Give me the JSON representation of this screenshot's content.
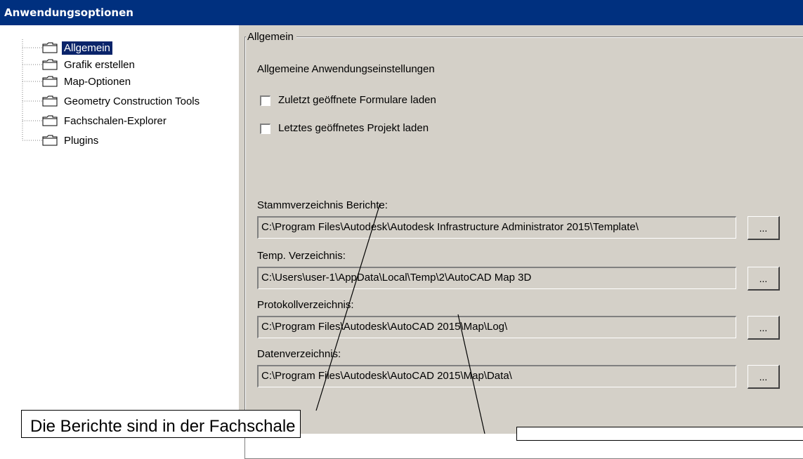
{
  "window": {
    "title": "Anwendungsoptionen"
  },
  "tree": {
    "items": [
      {
        "label": "Allgemein",
        "selected": true
      },
      {
        "label": "Grafik erstellen"
      },
      {
        "label": "Map-Optionen"
      },
      {
        "label": "Geometry Construction Tools"
      },
      {
        "label": "Fachschalen-Explorer"
      },
      {
        "label": "Plugins"
      }
    ]
  },
  "panel": {
    "group_title": "Allgemein",
    "subtitle": "Allgemeine  Anwendungseinstellungen",
    "checkboxes": [
      {
        "label": "Zuletzt geöffnete Formulare laden",
        "checked": false
      },
      {
        "label": "Letztes geöffnetes Projekt laden",
        "checked": false
      }
    ],
    "paths": [
      {
        "label": "Stammverzeichnis Berichte:",
        "value": "C:\\Program Files\\Autodesk\\Autodesk Infrastructure Administrator 2015\\Template\\",
        "button": "..."
      },
      {
        "label": "Temp. Verzeichnis:",
        "value": "C:\\Users\\user-1\\AppData\\Local\\Temp\\2\\AutoCAD Map 3D",
        "button": "..."
      },
      {
        "label": "Protokollverzeichnis:",
        "value": "C:\\Program Files\\Autodesk\\AutoCAD 2015\\Map\\Log\\",
        "button": "..."
      },
      {
        "label": "Datenverzeichnis:",
        "value": "C:\\Program Files\\Autodesk\\AutoCAD 2015\\Map\\Data\\",
        "button": "..."
      }
    ]
  },
  "callouts": [
    {
      "text": "Die Berichte sind in der Fachschale enthalten"
    },
    {
      "text": ""
    }
  ]
}
